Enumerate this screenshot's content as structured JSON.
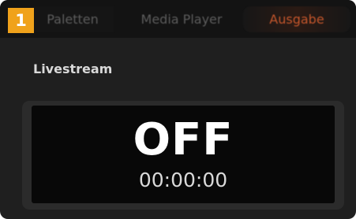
{
  "step_badge": "1",
  "tabs": [
    {
      "label": "Paletten",
      "active": false
    },
    {
      "label": "Media Player",
      "active": false
    },
    {
      "label": "Ausgabe",
      "active": true
    }
  ],
  "livestream": {
    "title": "Livestream",
    "status": "OFF",
    "duration": "00:00:00"
  },
  "colors": {
    "badge": "#f0a21b",
    "active_tab_text": "#c2552b",
    "panel_bg": "#1f1f1f",
    "display_bg": "#080808"
  }
}
